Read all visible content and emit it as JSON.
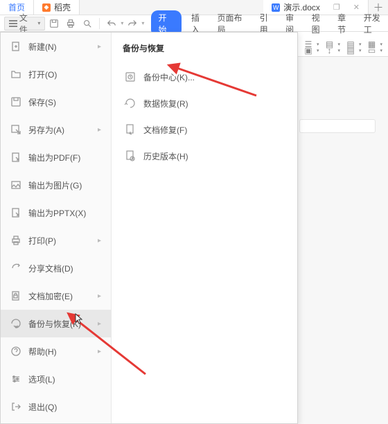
{
  "tabs": {
    "home": "首页",
    "shell": "稻壳",
    "doc": "演示.docx"
  },
  "toolbar": {
    "file_label": "文件"
  },
  "ribbon": {
    "tabs": [
      "开始",
      "插入",
      "页面布局",
      "引用",
      "审阅",
      "视图",
      "章节",
      "开发工"
    ]
  },
  "file_menu": {
    "items": [
      {
        "label": "新建(N)",
        "icon": "new",
        "has_sub": true
      },
      {
        "label": "打开(O)",
        "icon": "open",
        "has_sub": false
      },
      {
        "label": "保存(S)",
        "icon": "save",
        "has_sub": false
      },
      {
        "label": "另存为(A)",
        "icon": "saveas",
        "has_sub": true
      },
      {
        "label": "输出为PDF(F)",
        "icon": "pdf",
        "has_sub": false
      },
      {
        "label": "输出为图片(G)",
        "icon": "image",
        "has_sub": false
      },
      {
        "label": "输出为PPTX(X)",
        "icon": "pptx",
        "has_sub": false
      },
      {
        "label": "打印(P)",
        "icon": "print",
        "has_sub": true
      },
      {
        "label": "分享文档(D)",
        "icon": "share",
        "has_sub": false
      },
      {
        "label": "文档加密(E)",
        "icon": "encrypt",
        "has_sub": true
      },
      {
        "label": "备份与恢复(K)",
        "icon": "backup",
        "has_sub": true,
        "selected": true
      },
      {
        "label": "帮助(H)",
        "icon": "help",
        "has_sub": true
      },
      {
        "label": "选项(L)",
        "icon": "options",
        "has_sub": false
      },
      {
        "label": "退出(Q)",
        "icon": "exit",
        "has_sub": false
      }
    ]
  },
  "submenu": {
    "header": "备份与恢复",
    "items": [
      {
        "label": "备份中心(K)...",
        "icon": "backup-center"
      },
      {
        "label": "数据恢复(R)",
        "icon": "data-recover"
      },
      {
        "label": "文档修复(F)",
        "icon": "doc-repair"
      },
      {
        "label": "历史版本(H)",
        "icon": "history"
      }
    ]
  }
}
